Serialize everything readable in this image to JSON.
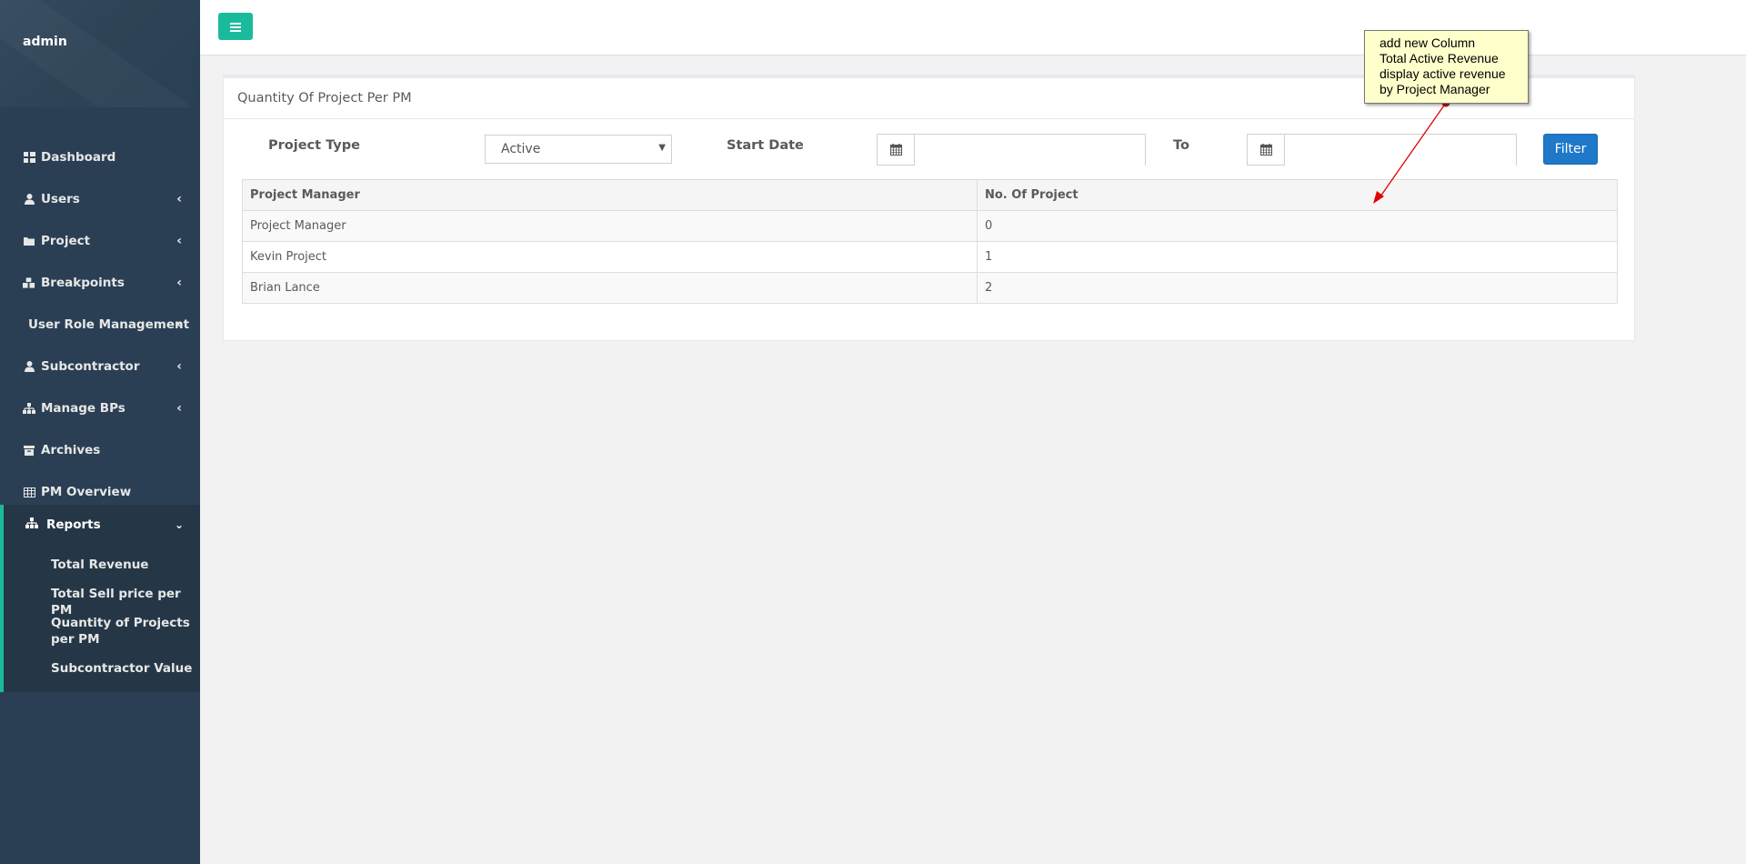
{
  "sidebar": {
    "profile_name": "admin",
    "items": [
      {
        "label": "Dashboard",
        "icon": "dashboard-icon",
        "has_chevron": false
      },
      {
        "label": "Users",
        "icon": "user-icon",
        "has_chevron": true
      },
      {
        "label": "Project",
        "icon": "folder-icon",
        "has_chevron": true
      },
      {
        "label": "Breakpoints",
        "icon": "cubes-icon",
        "has_chevron": true
      },
      {
        "label": "User Role Management",
        "icon": "",
        "has_chevron": true
      },
      {
        "label": "Subcontractor",
        "icon": "user-icon",
        "has_chevron": true
      },
      {
        "label": "Manage BPs",
        "icon": "sitemap-icon",
        "has_chevron": true
      },
      {
        "label": "Archives",
        "icon": "archive-icon",
        "has_chevron": false
      },
      {
        "label": "PM Overview",
        "icon": "table-icon",
        "has_chevron": false
      }
    ],
    "reports": {
      "label": "Reports",
      "icon": "sitemap-icon",
      "children": [
        "Total Revenue",
        "Total Sell price per PM",
        "Quantity of Projects per PM",
        "Subcontractor Value"
      ]
    }
  },
  "topbar": {
    "menu_icon": "hamburger-icon"
  },
  "panel": {
    "title": "Quantity Of Project Per PM",
    "filters": {
      "project_type_label": "Project Type",
      "project_type_value": "Active",
      "start_date_label": "Start Date",
      "start_date_value": "",
      "to_label": "To",
      "end_date_value": "",
      "filter_button": "Filter"
    },
    "table": {
      "headers": [
        "Project Manager",
        "No. Of Project"
      ],
      "rows": [
        [
          "Project Manager",
          "0"
        ],
        [
          "Kevin Project",
          "1"
        ],
        [
          "Brian Lance",
          "2"
        ]
      ]
    }
  },
  "annotation": {
    "lines": [
      "add new Column",
      "Total Active Revenue",
      "display active revenue",
      "by Project Manager"
    ]
  },
  "colors": {
    "sidebar_bg": "#2a3f54",
    "accent": "#1abb9c",
    "filter_button": "#1f78c8",
    "note_bg": "#ffffcc",
    "arrow": "#e00000"
  }
}
